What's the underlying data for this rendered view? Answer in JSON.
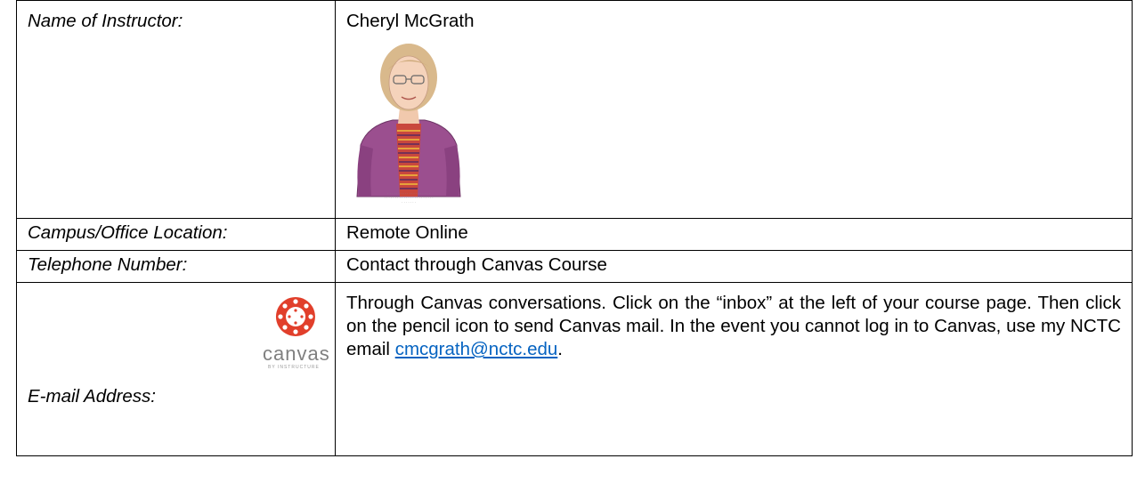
{
  "rows": {
    "name": {
      "label": "Name of Instructor:",
      "value": "Cheryl McGrath"
    },
    "campus": {
      "label": "Campus/Office Location:",
      "value": "Remote Online"
    },
    "phone": {
      "label": "Telephone Number:",
      "value": "Contact through Canvas Course"
    },
    "email": {
      "label": "E-mail Address:",
      "logo_word": "canvas",
      "logo_sub": "BY INSTRUCTURE",
      "body": "Through Canvas conversations. Click on the “inbox” at the left of your course page. Then click on the pencil icon to send Canvas mail.  In the event you cannot log in to Canvas, use my NCTC email ",
      "link_text": "cmcgrath@nctc.edu",
      "suffix": "."
    }
  },
  "colors": {
    "canvas_red": "#e13f2b",
    "canvas_gray": "#808080",
    "link": "#0563c1",
    "sweater": "#9b4f8f"
  }
}
